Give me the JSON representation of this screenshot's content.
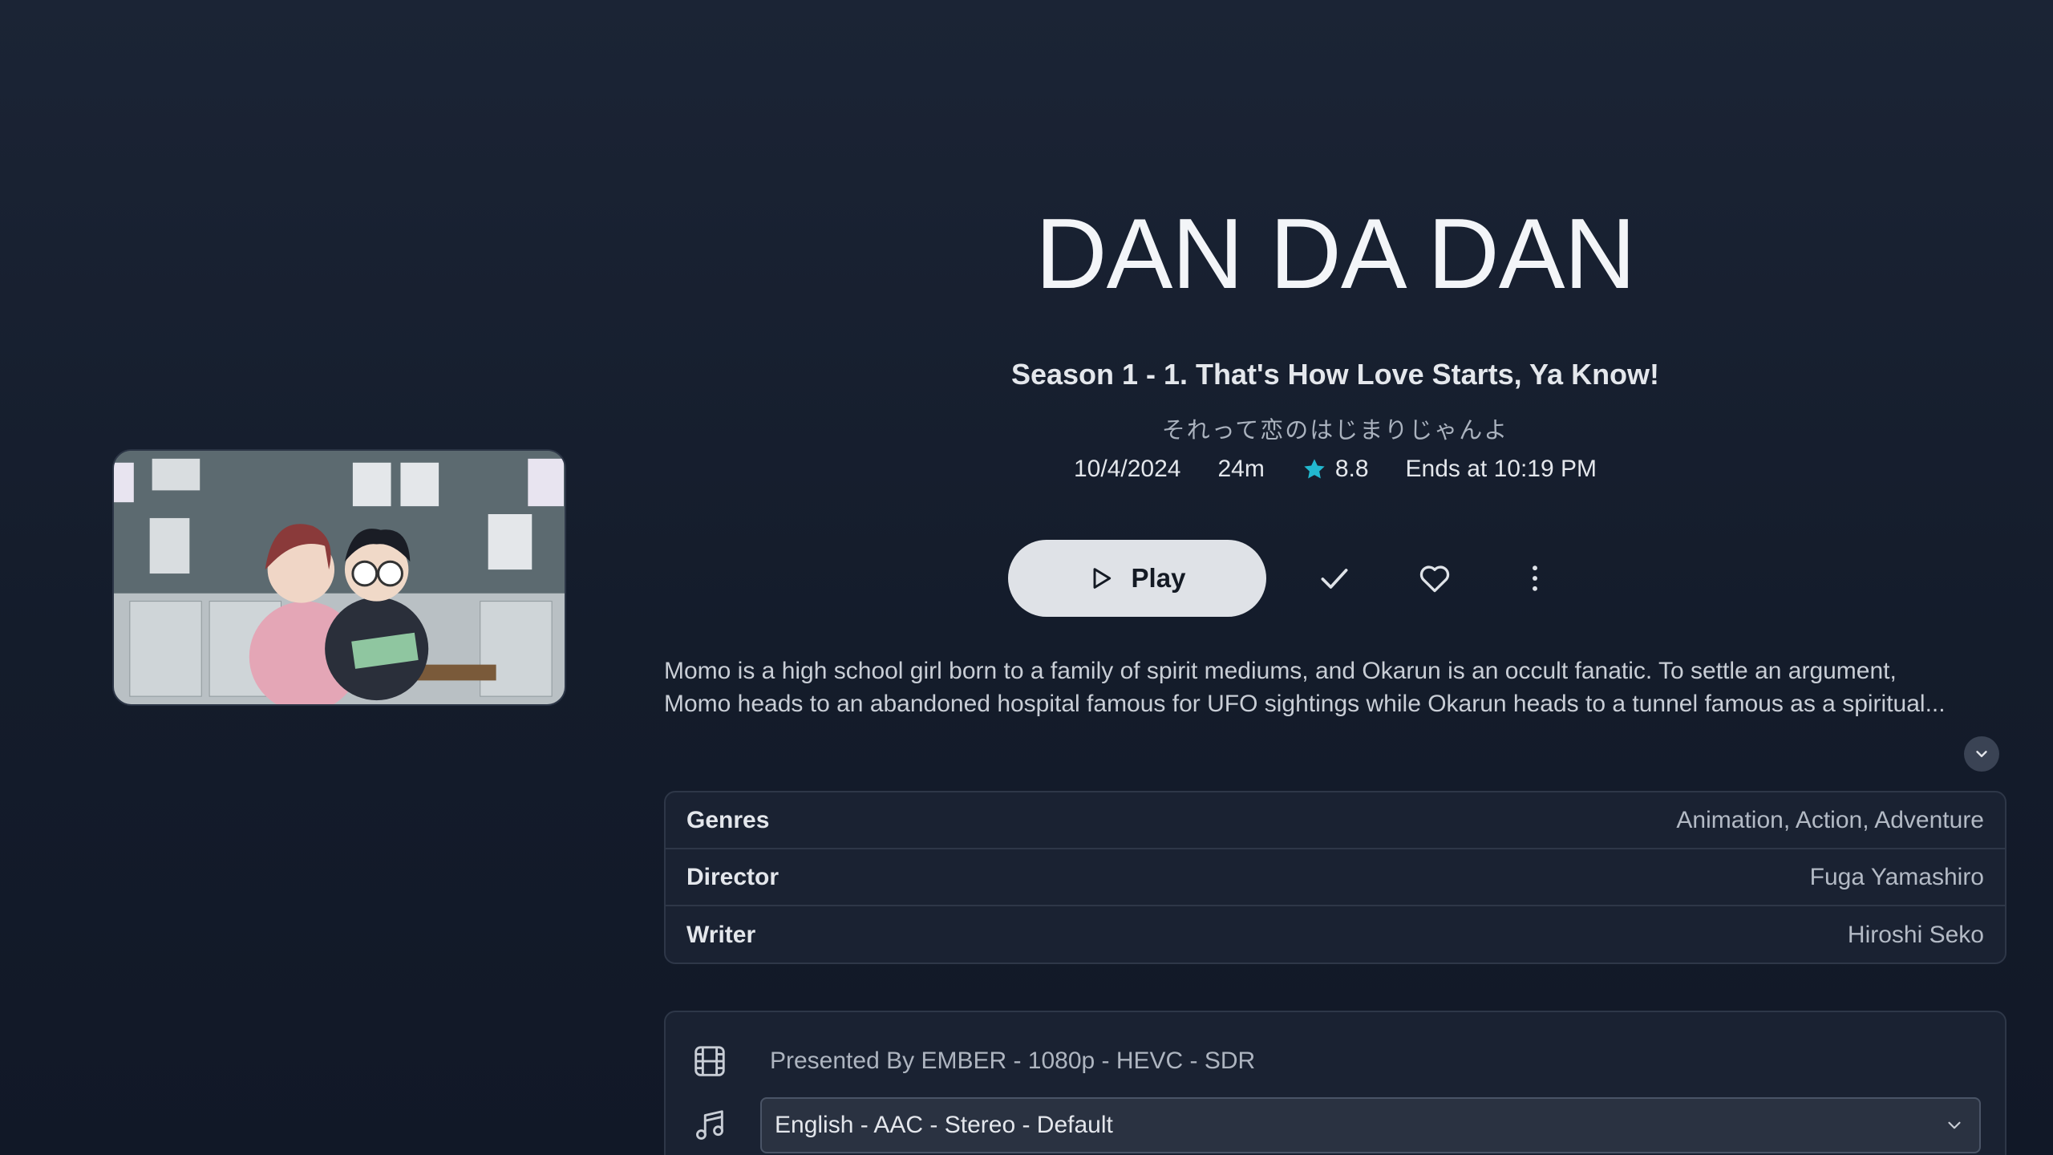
{
  "title": "DAN DA DAN",
  "episode": {
    "subtitle": "Season 1 - 1. That's How Love Starts, Ya Know!",
    "original_title": "それって恋のはじまりじゃんよ",
    "date": "10/4/2024",
    "runtime": "24m",
    "rating": "8.8",
    "ends_at": "Ends at 10:19 PM"
  },
  "actions": {
    "play_label": "Play"
  },
  "overview": {
    "line1": "Momo is a high school girl born to a family of spirit mediums, and Okarun is an occult fanatic. To settle an argument,",
    "line2": "Momo heads to an abandoned hospital famous for UFO sightings while Okarun heads to a tunnel famous as a spiritual..."
  },
  "details": [
    {
      "key": "Genres",
      "value": "Animation, Action, Adventure"
    },
    {
      "key": "Director",
      "value": "Fuga Yamashiro"
    },
    {
      "key": "Writer",
      "value": "Hiroshi Seko"
    }
  ],
  "media": {
    "video": "Presented By EMBER - 1080p - HEVC - SDR",
    "audio_selected": "English - AAC - Stereo - Default"
  },
  "colors": {
    "background": "#1b2435",
    "accent_star": "#22b8cf",
    "play_button": "#dfe2e7"
  },
  "icons": [
    "play-icon",
    "check-icon",
    "heart-icon",
    "more-vertical-icon",
    "chevron-down-icon",
    "film-icon",
    "music-icon",
    "star-icon"
  ]
}
